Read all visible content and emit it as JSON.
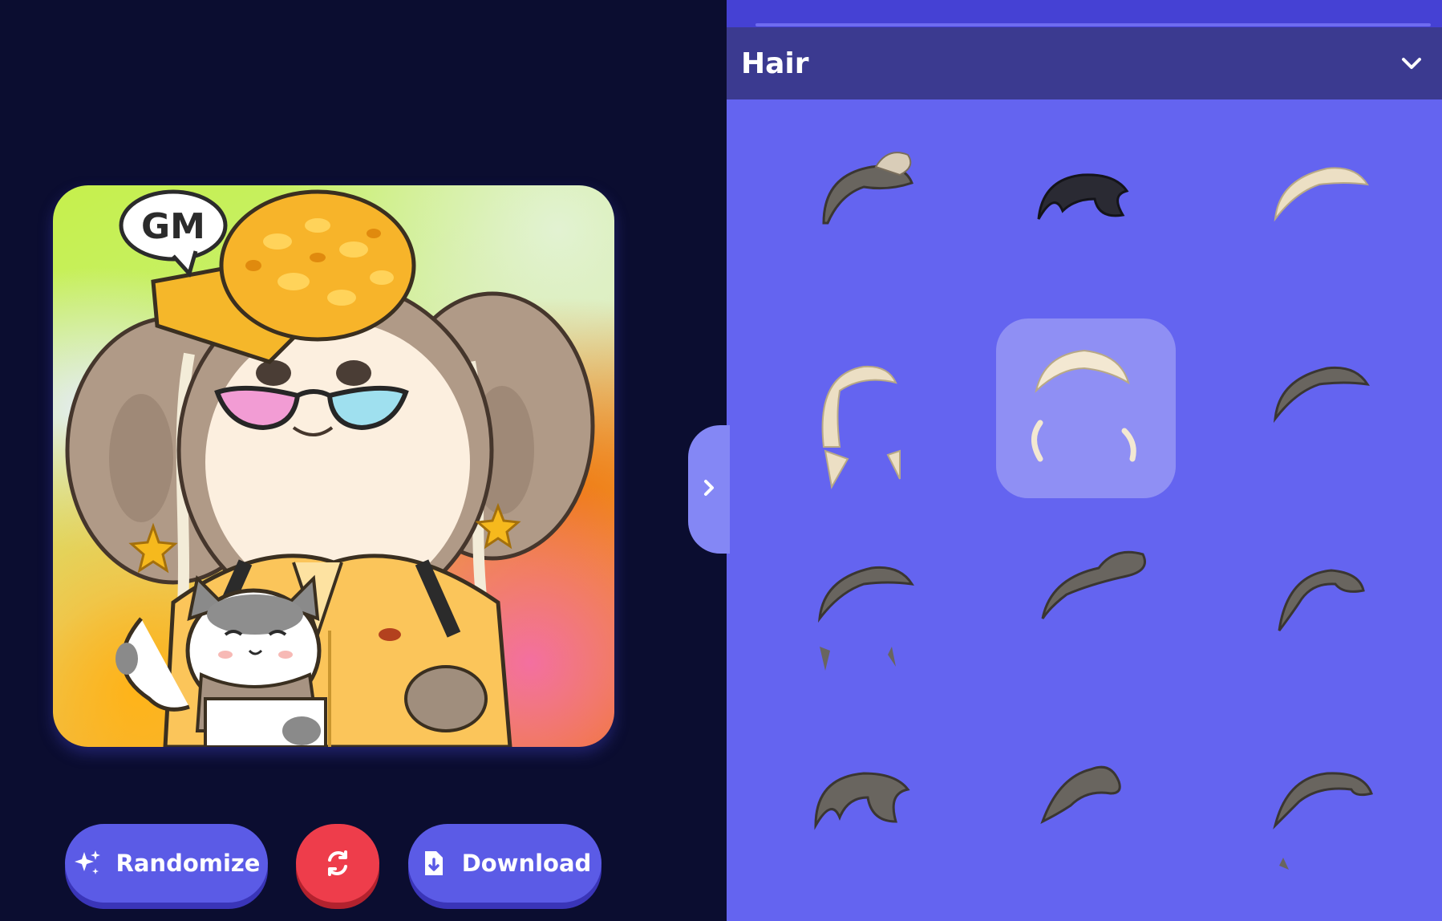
{
  "preview": {
    "speech_bubble_text": "GM",
    "avatar_description": "cartoon mouse avatar"
  },
  "actions": {
    "randomize_label": "Randomize",
    "download_label": "Download",
    "reset_icon": "refresh-icon"
  },
  "panel": {
    "section_title": "Hair",
    "expand_icon": "chevron-down-icon",
    "collapse_icon": "chevron-right-icon",
    "selected_index": 4,
    "options": [
      {
        "name": "hair-option-1",
        "tone": "dark"
      },
      {
        "name": "hair-option-2",
        "tone": "black"
      },
      {
        "name": "hair-option-3",
        "tone": "cream"
      },
      {
        "name": "hair-option-4",
        "tone": "cream"
      },
      {
        "name": "hair-option-5",
        "tone": "cream"
      },
      {
        "name": "hair-option-6",
        "tone": "dark"
      },
      {
        "name": "hair-option-7",
        "tone": "dark"
      },
      {
        "name": "hair-option-8",
        "tone": "dark"
      },
      {
        "name": "hair-option-9",
        "tone": "dark"
      },
      {
        "name": "hair-option-10",
        "tone": "dark"
      },
      {
        "name": "hair-option-11",
        "tone": "dark"
      },
      {
        "name": "hair-option-12",
        "tone": "dark"
      }
    ]
  },
  "colors": {
    "left_bg": "#0b0d30",
    "right_bg": "#6464f0",
    "header_bg": "#3b3a90",
    "primary_button": "#5b5be6",
    "danger_button": "#ee3d4b"
  }
}
